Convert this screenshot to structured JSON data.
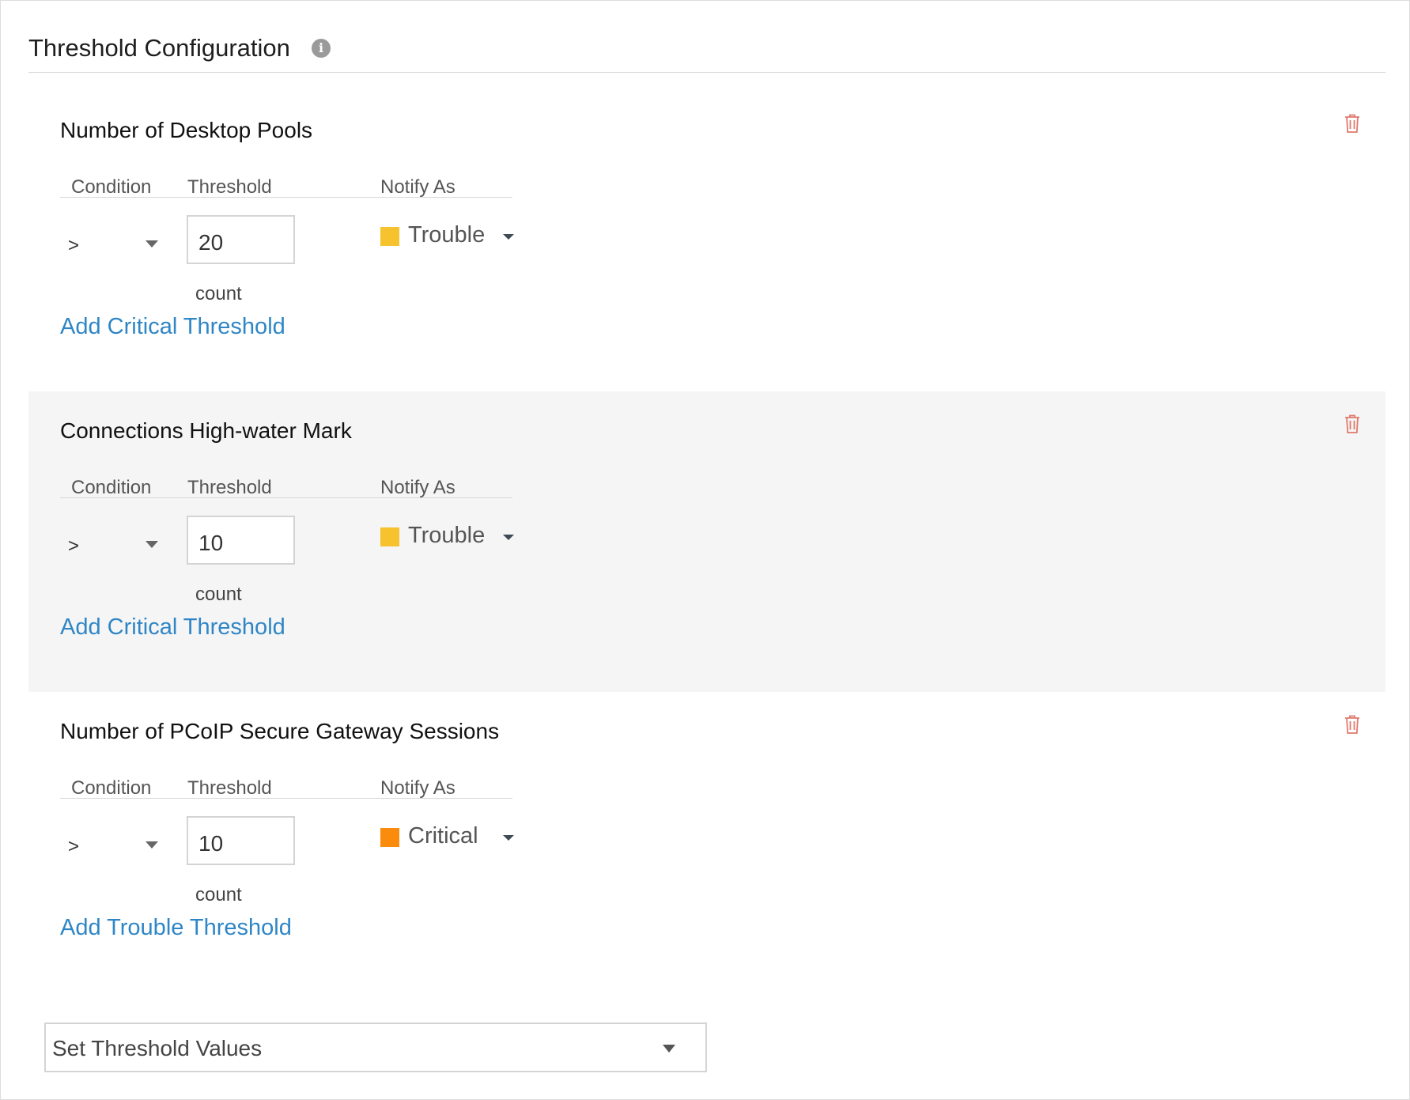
{
  "header": {
    "title": "Threshold Configuration",
    "info_icon": "info-icon",
    "info_glyph": "i"
  },
  "columns": {
    "condition": "Condition",
    "threshold": "Threshold",
    "notify_as": "Notify As"
  },
  "colors": {
    "trouble": "#f6c22d",
    "critical": "#fb8b0c",
    "link": "#2f86c6",
    "delete_icon": "#e07a6e"
  },
  "sections": [
    {
      "title": "Number of Desktop Pools",
      "condition": ">",
      "threshold": "20",
      "unit": "count",
      "severity": "Trouble",
      "severity_color": "#f6c22d",
      "add_link": "Add Critical Threshold",
      "shaded": false
    },
    {
      "title": "Connections High-water Mark",
      "condition": ">",
      "threshold": "10",
      "unit": "count",
      "severity": "Trouble",
      "severity_color": "#f6c22d",
      "add_link": "Add Critical Threshold",
      "shaded": true
    },
    {
      "title": "Number of PCoIP Secure Gateway Sessions",
      "condition": ">",
      "threshold": "10",
      "unit": "count",
      "severity": "Critical",
      "severity_color": "#fb8b0c",
      "add_link": "Add Trouble Threshold",
      "shaded": false
    }
  ],
  "footer_select": {
    "label": "Set Threshold Values"
  }
}
